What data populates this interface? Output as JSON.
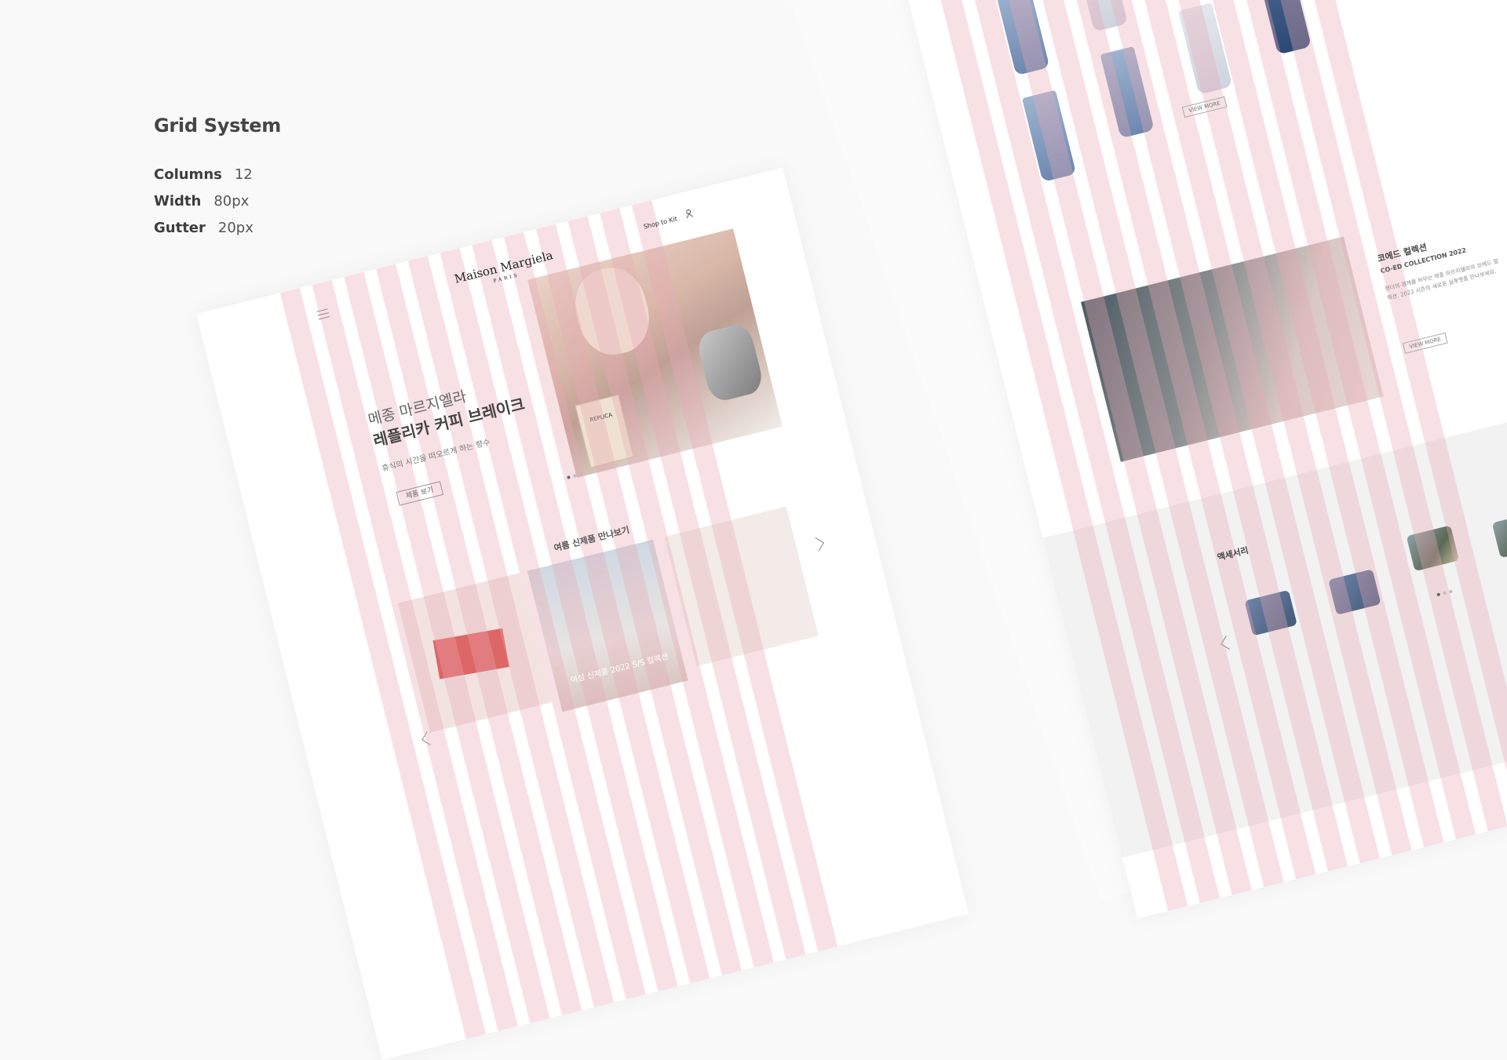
{
  "spec": {
    "title": "Grid System",
    "rows": [
      {
        "key": "Columns",
        "value": "12"
      },
      {
        "key": "Width",
        "value": "80px"
      },
      {
        "key": "Gutter",
        "value": "20px"
      }
    ]
  },
  "left_mockup": {
    "logo_main": "Maison Margiela",
    "logo_sub": "PARIS",
    "nav_link": "Shop to Kit",
    "hero_sub": "메종 마르지엘라",
    "hero_main": "레플리카 커피 브레이크",
    "hero_desc": "휴식의 시간을 떠오르게 하는 향수",
    "hero_button": "제품 보기",
    "bottle_label": "REPLICA",
    "section_title": "여름 신제품 만나보기",
    "card_caption": "여성 신제품 2022 S/S 컬렉션"
  },
  "right_mockup": {
    "view_more_1": "VIEW MORE",
    "co_title": "코에드 컬렉션",
    "co_sub": "CO-ED COLLECTION 2022",
    "co_body": "젠더의 경계를 허무는 메종 마르지엘라의 코에드 컬렉션. 2022 시즌의 새로운 실루엣을 만나보세요.",
    "view_more_2": "VIEW MORE",
    "acc_title": "액세서리"
  },
  "colors": {
    "grid_column": "#e7aab4",
    "background": "#f9f9f9"
  }
}
